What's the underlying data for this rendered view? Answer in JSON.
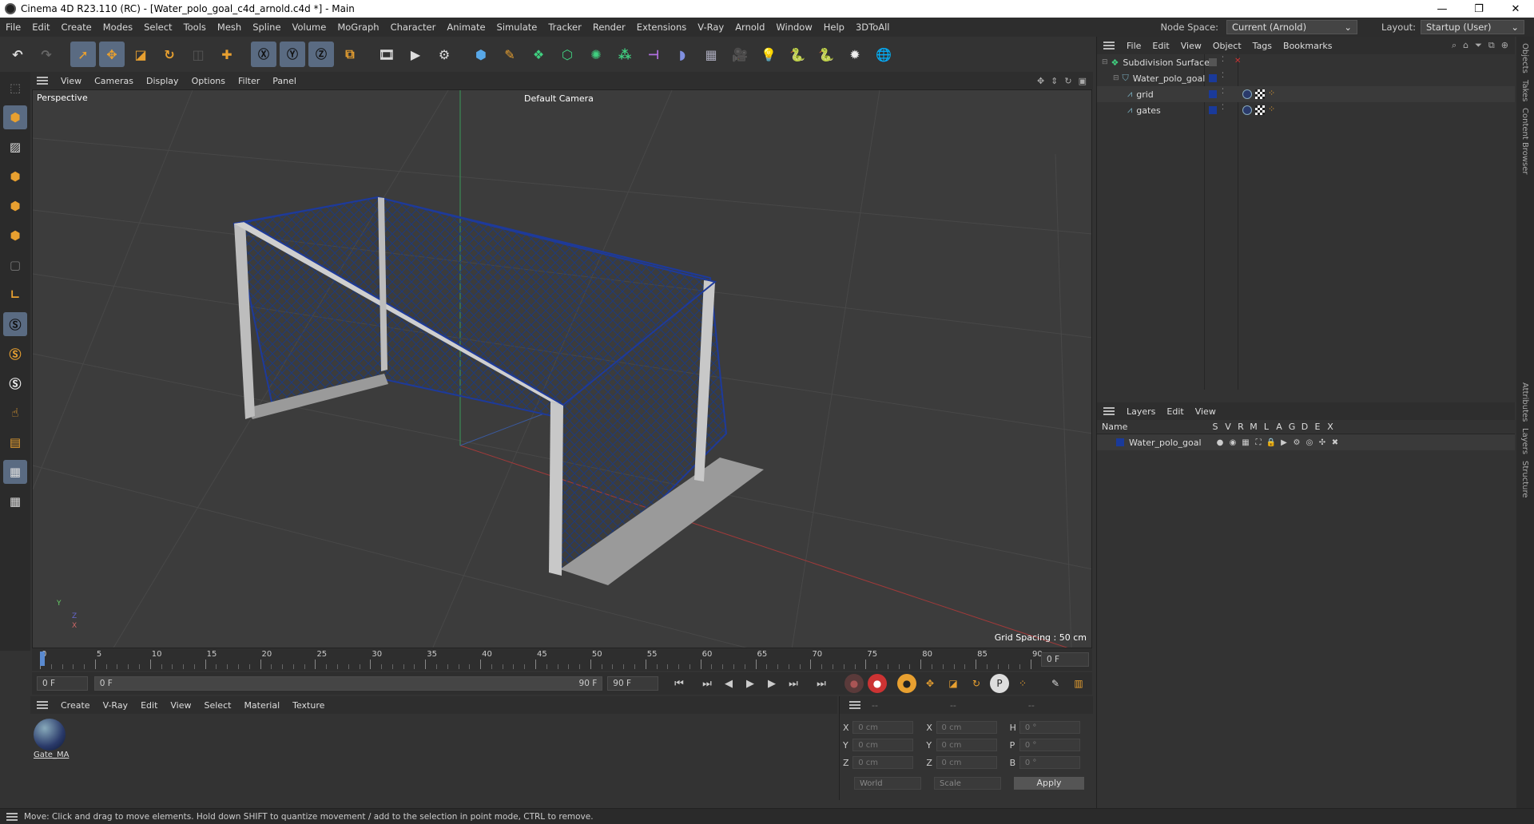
{
  "window": {
    "title": "Cinema 4D R23.110 (RC) - [Water_polo_goal_c4d_arnold.c4d *] - Main",
    "controls": [
      "—",
      "❐",
      "✕"
    ]
  },
  "menubar": {
    "items": [
      "File",
      "Edit",
      "Create",
      "Modes",
      "Select",
      "Tools",
      "Mesh",
      "Spline",
      "Volume",
      "MoGraph",
      "Character",
      "Animate",
      "Simulate",
      "Tracker",
      "Render",
      "Extensions",
      "V-Ray",
      "Arnold",
      "Window",
      "Help",
      "3DToAll"
    ],
    "node_space_label": "Node Space:",
    "node_space_value": "Current (Arnold)",
    "layout_label": "Layout:",
    "layout_value": "Startup (User)"
  },
  "viewport": {
    "menu": [
      "View",
      "Cameras",
      "Display",
      "Options",
      "Filter",
      "Panel"
    ],
    "view_name": "Perspective",
    "camera_name": "Default Camera",
    "grid_spacing": "Grid Spacing : 50 cm",
    "axis_y": "Y",
    "axis_z": "Z",
    "axis_x": "X"
  },
  "timeline": {
    "ticks": [
      "0",
      "5",
      "10",
      "15",
      "20",
      "25",
      "30",
      "35",
      "40",
      "45",
      "50",
      "55",
      "60",
      "65",
      "70",
      "75",
      "80",
      "85",
      "90"
    ],
    "frame_end_field": "0 F"
  },
  "transport": {
    "start_field": "0 F",
    "range_start": "0 F",
    "range_end": "90 F",
    "end_field": "90 F"
  },
  "materials": {
    "menu": [
      "Create",
      "V-Ray",
      "Edit",
      "View",
      "Select",
      "Material",
      "Texture"
    ],
    "swatch_label": "Gate_MA"
  },
  "coordinates": {
    "header": [
      "--",
      "--",
      "--"
    ],
    "rows": [
      {
        "a": "X",
        "av": "0 cm",
        "b": "X",
        "bv": "0 cm",
        "c": "H",
        "cv": "0 °"
      },
      {
        "a": "Y",
        "av": "0 cm",
        "b": "Y",
        "bv": "0 cm",
        "c": "P",
        "cv": "0 °"
      },
      {
        "a": "Z",
        "av": "0 cm",
        "b": "Z",
        "bv": "0 cm",
        "c": "B",
        "cv": "0 °"
      }
    ],
    "mode": "World",
    "type": "Scale",
    "apply": "Apply"
  },
  "objects": {
    "menu": [
      "File",
      "Edit",
      "View",
      "Object",
      "Tags",
      "Bookmarks"
    ],
    "items": [
      {
        "name": "Subdivision Surface",
        "indent": 0
      },
      {
        "name": "Water_polo_goal",
        "indent": 1
      },
      {
        "name": "grid",
        "indent": 2
      },
      {
        "name": "gates",
        "indent": 2
      }
    ]
  },
  "layers": {
    "menu": [
      "Layers",
      "Edit",
      "View"
    ],
    "columns": [
      "Name",
      "S",
      "V",
      "R",
      "M",
      "L",
      "A",
      "G",
      "D",
      "E",
      "X"
    ],
    "items": [
      {
        "name": "Water_polo_goal",
        "color": "#1a3a9a"
      }
    ]
  },
  "side_tabs": [
    "Objects",
    "Takes",
    "Content Browser",
    "Attributes",
    "Layers",
    "Structure"
  ],
  "status": "Move: Click and drag to move elements. Hold down SHIFT to quantize movement / add to the selection in point mode, CTRL to remove.",
  "colors": {
    "accent": "#5a6b82",
    "blue_layer": "#1a3a9a",
    "orange": "#e8a030"
  }
}
